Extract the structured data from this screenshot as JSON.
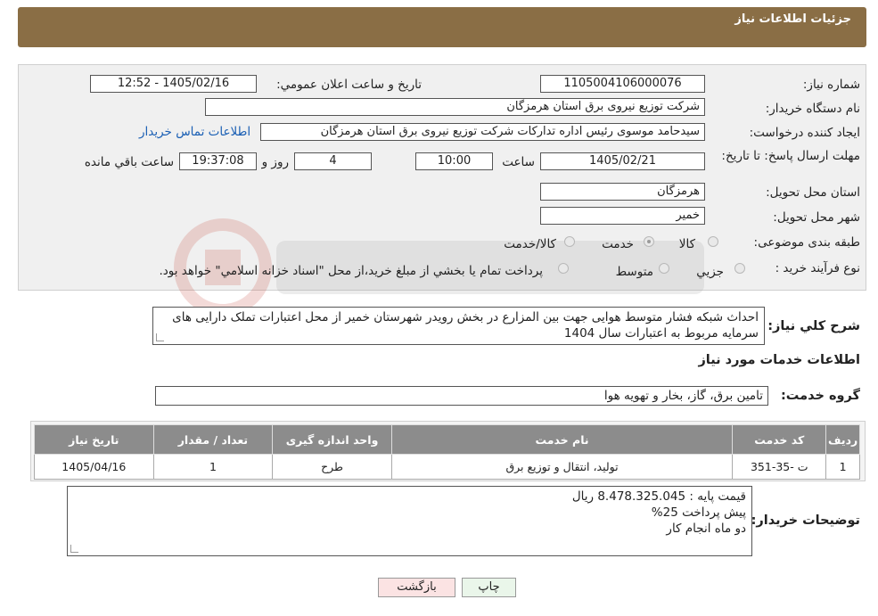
{
  "header": {
    "title": "جزئیات اطلاعات نیاز"
  },
  "form": {
    "need_number_label": "شماره نیاز:",
    "need_number": "1105004106000076",
    "announce_label": "تاريخ و ساعت اعلان عمومي:",
    "announce_value": "1405/02/16 - 12:52",
    "buyer_org_label": "نام دستگاه خريدار:",
    "buyer_org": "شرکت توزیع نیروی برق استان هرمزگان",
    "creator_label": "ايجاد کننده درخواست:",
    "creator": "سیدحامد موسوی رئیس اداره تدارکات شرکت توزیع نیروی برق استان هرمزگان",
    "contact_link": "اطلاعات تماس خريدار",
    "deadline_label": "مهلت ارسال پاسخ: تا تاریخ:",
    "deadline_date": "1405/02/21",
    "time_label": "ساعت",
    "deadline_time": "10:00",
    "days_value": "4",
    "days_label": "روز و",
    "remaining_time": "19:37:08",
    "remaining_label": "ساعت باقي مانده",
    "province_label": "استان محل تحویل:",
    "province": "هرمزگان",
    "city_label": "شهر محل تحویل:",
    "city": "خمير",
    "category_label": "طبقه بندی موضوعی:",
    "category_options": [
      "کالا",
      "خدمت",
      "کالا/خدمت"
    ],
    "process_label": "نوع فرآیند خرید :",
    "process_options": [
      "جزيي",
      "متوسط"
    ],
    "process_note": "پرداخت تمام يا بخشي از مبلغ خريد،از محل \"اسناد خزانه اسلامي\" خواهد بود."
  },
  "summary": {
    "label": "شرح کلي نياز:",
    "text": "احداث شبکه فشار متوسط هوایی جهت  بین المزارع در بخش رویدر شهرستان خمیر  از محل اعتبارات تملک دارایی های سرمایه مربوط به اعتبارات سال 1404"
  },
  "services": {
    "section_title": "اطلاعات خدمات مورد نياز",
    "group_label": "گروه خدمت:",
    "group_value": "تامین برق، گاز، بخار و تهویه هوا",
    "columns": [
      "رديف",
      "کد خدمت",
      "نام خدمت",
      "واحد اندازه گيری",
      "تعداد / مقدار",
      "تاريخ نياز"
    ],
    "rows": [
      [
        "1",
        "ت -35-351",
        "تولید، انتقال و توزیع برق",
        "طرح",
        "1",
        "1405/04/16"
      ]
    ]
  },
  "buyer_notes": {
    "label": "توضيحات خريدار:",
    "lines": [
      "قیمت پایه : 8.478.325.045 ریال",
      "پیش پرداخت 25%",
      "دو ماه انجام کار"
    ]
  },
  "buttons": {
    "print": "چاپ",
    "back": "بازگشت"
  },
  "colors": {
    "header_bg": "#8a6e45",
    "table_header_bg": "#8c8c8c",
    "back_button_bg": "#fbe3e3",
    "print_button_bg": "#eaf6ea"
  }
}
